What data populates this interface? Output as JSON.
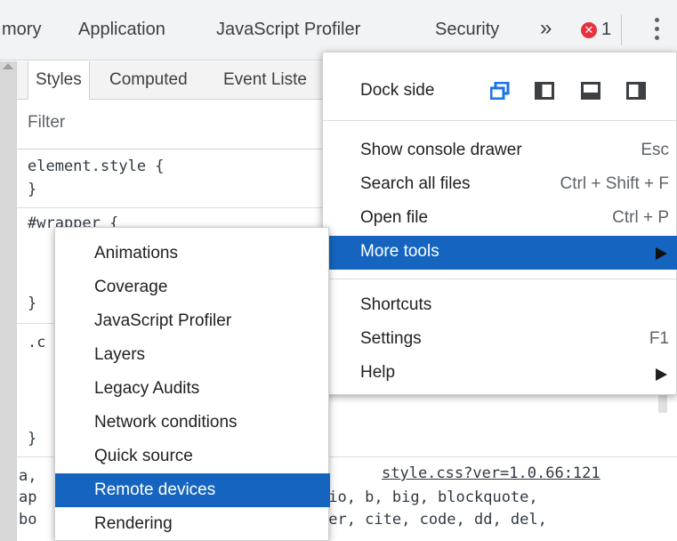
{
  "top_tabs": [
    "mory",
    "Application",
    "JavaScript Profiler",
    "Security"
  ],
  "overflow_icon": "double-chevron-right",
  "error_count": "1",
  "styles_pane": {
    "tabs": [
      "Styles",
      "Computed",
      "Event Liste"
    ],
    "filter_placeholder": "Filter",
    "rules": {
      "element_style_open": "element.style {",
      "element_style_close": "}",
      "wrapper_open": "#wrapper {",
      "wrapper_close": "}",
      "c_selector_fragment": ".c",
      "c_close": "}",
      "a_fragment": "a,",
      "ap_fragment": "ap",
      "bo_fragment": "bo",
      "line1_tail": "dio, b, big, blockquote,",
      "line2_tail": "ter, cite, code, dd, del,",
      "source_link": "style.css?ver=1.0.66:121"
    }
  },
  "main_menu": {
    "dock_side_label": "Dock side",
    "dock_options": [
      "undock-icon",
      "dock-left-icon",
      "dock-bottom-icon",
      "dock-right-icon"
    ],
    "items": [
      {
        "label": "Show console drawer",
        "shortcut": "Esc"
      },
      {
        "label": "Search all files",
        "shortcut": "Ctrl + Shift + F"
      },
      {
        "label": "Open file",
        "shortcut": "Ctrl + P"
      },
      {
        "label": "More tools",
        "shortcut": ""
      },
      {
        "label": "Shortcuts",
        "shortcut": ""
      },
      {
        "label": "Settings",
        "shortcut": "F1"
      },
      {
        "label": "Help",
        "shortcut": ""
      }
    ]
  },
  "more_tools_submenu": {
    "items": [
      "Animations",
      "Coverage",
      "JavaScript Profiler",
      "Layers",
      "Legacy Audits",
      "Network conditions",
      "Quick source",
      "Remote devices",
      "Rendering"
    ],
    "highlighted": "Remote devices"
  },
  "colors": {
    "highlight": "#1565c0",
    "error_badge": "#e8313c",
    "dock_active": "#1a73e8"
  }
}
